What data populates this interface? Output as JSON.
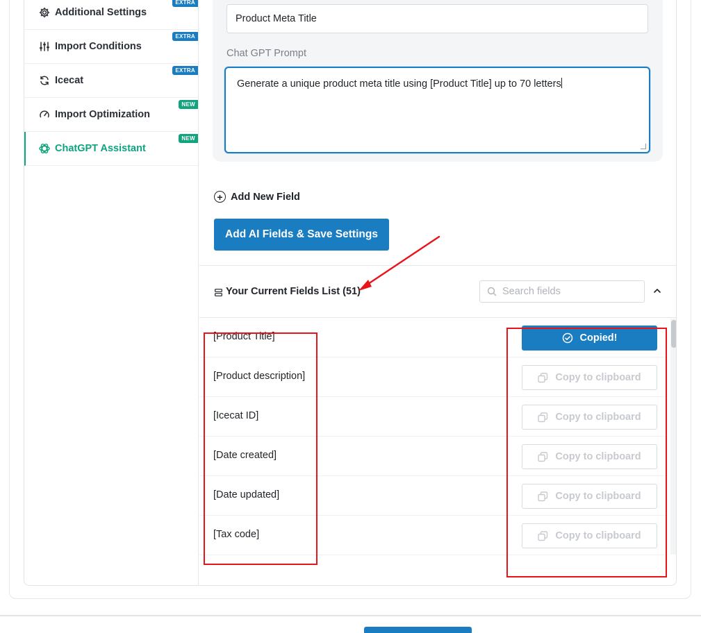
{
  "sidebar": {
    "items": [
      {
        "label": "Additional Settings",
        "badge": "EXTRA",
        "icon": "gear-icon"
      },
      {
        "label": "Import Conditions",
        "badge": "EXTRA",
        "icon": "sliders-icon"
      },
      {
        "label": "Icecat",
        "badge": "EXTRA",
        "icon": "refresh-icon"
      },
      {
        "label": "Import Optimization",
        "badge": "NEW",
        "icon": "gauge-icon"
      },
      {
        "label": "ChatGPT Assistant",
        "badge": "NEW",
        "icon": "openai-icon",
        "active": true
      }
    ]
  },
  "form": {
    "field_name_value": "Product Meta Title",
    "prompt_label": "Chat GPT Prompt",
    "prompt_value": "Generate a unique product meta title using [Product Title] up to 70 letters",
    "add_field_label": "Add New Field",
    "save_button_label": "Add AI Fields & Save Settings"
  },
  "fields_list": {
    "title": "Your Current Fields List (51)",
    "search_placeholder": "Search fields",
    "rows": [
      {
        "name": "[Product Title]",
        "button": "Copied!",
        "copied": true
      },
      {
        "name": "[Product description]",
        "button": "Copy to clipboard",
        "copied": false
      },
      {
        "name": "[Icecat ID]",
        "button": "Copy to clipboard",
        "copied": false
      },
      {
        "name": "[Date created]",
        "button": "Copy to clipboard",
        "copied": false
      },
      {
        "name": "[Date updated]",
        "button": "Copy to clipboard",
        "copied": false
      },
      {
        "name": "[Tax code]",
        "button": "Copy to clipboard",
        "copied": false
      }
    ]
  },
  "colors": {
    "primary": "#1a7cc1",
    "accent_green": "#10a37f",
    "annotation_red": "#e8141a"
  }
}
